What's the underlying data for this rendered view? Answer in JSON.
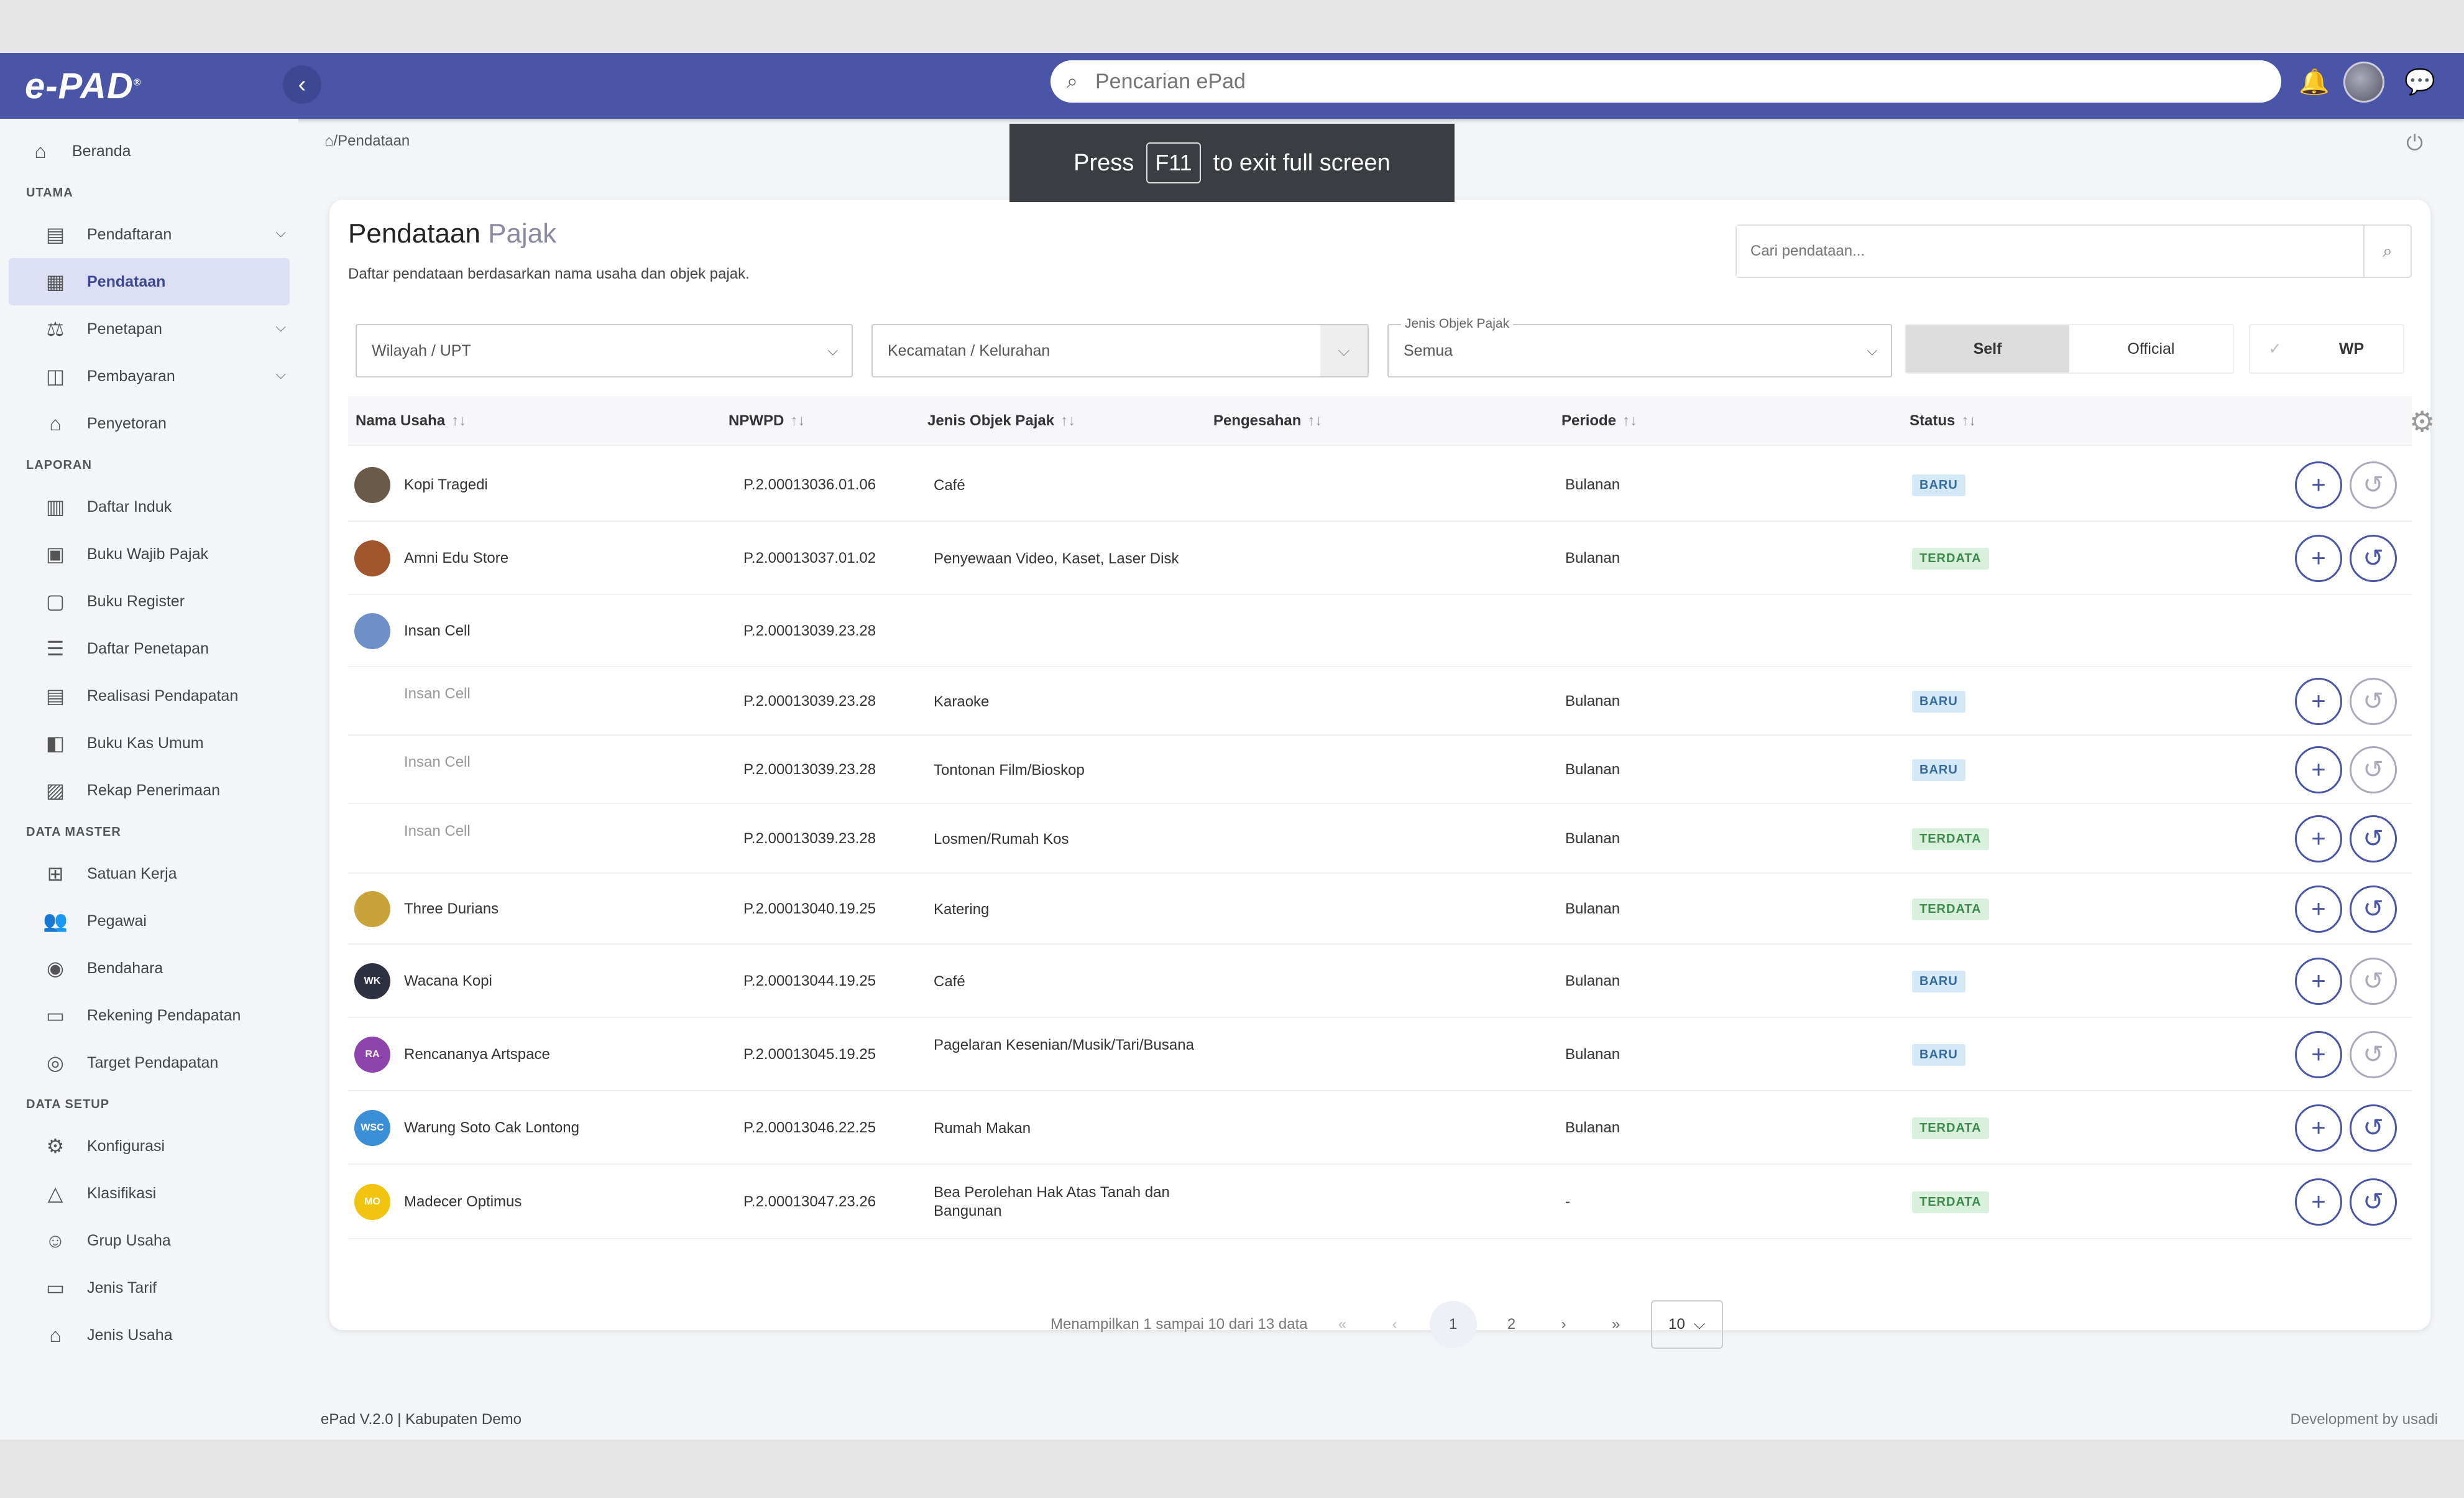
{
  "app": {
    "logo": "e-PAD",
    "search_placeholder": "Pencarian ePad"
  },
  "fullscreen": {
    "press": "Press",
    "key": "F11",
    "msg": "to exit full screen"
  },
  "breadcrumb": "/Pendataan",
  "sidebar": {
    "home": "Beranda",
    "sections": [
      {
        "title": "UTAMA",
        "items": [
          "Pendaftaran",
          "Pendataan",
          "Penetapan",
          "Pembayaran",
          "Penyetoran"
        ]
      },
      {
        "title": "LAPORAN",
        "items": [
          "Daftar Induk",
          "Buku Wajib Pajak",
          "Buku Register",
          "Daftar Penetapan",
          "Realisasi Pendapatan",
          "Buku Kas Umum",
          "Rekap Penerimaan"
        ]
      },
      {
        "title": "DATA MASTER",
        "items": [
          "Satuan Kerja",
          "Pegawai",
          "Bendahara",
          "Rekening Pendapatan",
          "Target Pendapatan"
        ]
      },
      {
        "title": "DATA SETUP",
        "items": [
          "Konfigurasi",
          "Klasifikasi",
          "Grup Usaha",
          "Jenis Tarif",
          "Jenis Usaha"
        ]
      }
    ]
  },
  "card": {
    "title_a": "Pendataan",
    "title_b": "Pajak",
    "desc": "Daftar pendataan berdasarkan nama usaha dan objek pajak.",
    "search_placeholder": "Cari pendataan...",
    "filter_wilayah": "Wilayah / UPT",
    "filter_kecamatan": "Kecamatan / Kelurahan",
    "filter_jenis_legend": "Jenis Objek Pajak",
    "filter_jenis_value": "Semua",
    "toggle_self": "Self",
    "toggle_official": "Official",
    "wp": "WP"
  },
  "table": {
    "headers": [
      "Nama Usaha",
      "NPWPD",
      "Jenis Objek Pajak",
      "Pengesahan",
      "Periode",
      "Status"
    ],
    "rows": [
      {
        "name": "Kopi Tragedi",
        "npwpd": "P.2.00013036.01.06",
        "jenis": "Café",
        "periode": "Bulanan",
        "status": "BARU",
        "av": "img",
        "color": "#6b5a4a"
      },
      {
        "name": "Amni Edu Store",
        "npwpd": "P.2.00013037.01.02",
        "jenis": "Penyewaan Video, Kaset, Laser Disk",
        "periode": "Bulanan",
        "status": "TERDATA",
        "av": "img",
        "color": "#a0552a"
      },
      {
        "name": "Insan Cell",
        "npwpd": "P.2.00013039.23.28",
        "jenis": "",
        "periode": "",
        "status": "",
        "av": "img",
        "color": "#6f8fc8"
      },
      {
        "name": "Insan Cell",
        "npwpd": "P.2.00013039.23.28",
        "jenis": "Karaoke",
        "periode": "Bulanan",
        "status": "BARU",
        "sub": true
      },
      {
        "name": "Insan Cell",
        "npwpd": "P.2.00013039.23.28",
        "jenis": "Tontonan Film/Bioskop",
        "periode": "Bulanan",
        "status": "BARU",
        "sub": true
      },
      {
        "name": "Insan Cell",
        "npwpd": "P.2.00013039.23.28",
        "jenis": "Losmen/Rumah Kos",
        "periode": "Bulanan",
        "status": "TERDATA",
        "sub": true
      },
      {
        "name": "Three Durians",
        "npwpd": "P.2.00013040.19.25",
        "jenis": "Katering",
        "periode": "Bulanan",
        "status": "TERDATA",
        "av": "img",
        "color": "#c9a23a"
      },
      {
        "name": "Wacana Kopi",
        "npwpd": "P.2.00013044.19.25",
        "jenis": "Café",
        "periode": "Bulanan",
        "status": "BARU",
        "av": "WK",
        "color": "#2d3142"
      },
      {
        "name": "Rencananya Artspace",
        "npwpd": "P.2.00013045.19.25",
        "jenis": "Pagelaran Kesenian/Musik/Tari/Busana",
        "periode": "Bulanan",
        "status": "BARU",
        "av": "RA",
        "color": "#8e44ad"
      },
      {
        "name": "Warung Soto Cak Lontong",
        "npwpd": "P.2.00013046.22.25",
        "jenis": "Rumah Makan",
        "periode": "Bulanan",
        "status": "TERDATA",
        "av": "WSC",
        "color": "#3b8fd6"
      },
      {
        "name": "Madecer Optimus",
        "npwpd": "P.2.00013047.23.26",
        "jenis": "Bea Perolehan Hak Atas Tanah dan Bangunan",
        "periode": "-",
        "status": "TERDATA",
        "av": "MO",
        "color": "#f1c40f"
      }
    ]
  },
  "pager": {
    "info": "Menampilkan 1 sampai 10 dari 13 data",
    "pages": [
      "1",
      "2"
    ],
    "size": "10"
  },
  "footer": {
    "left": "ePad V.2.0 | Kabupaten Demo",
    "right": "Development by usadi"
  }
}
